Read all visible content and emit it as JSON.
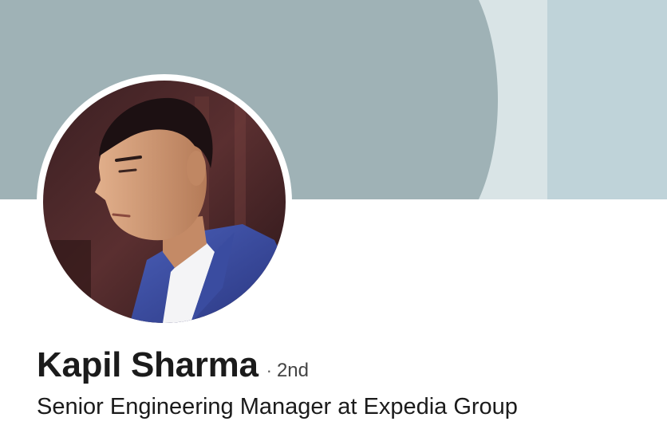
{
  "profile": {
    "name": "Kapil Sharma",
    "separator": "·",
    "connection_degree": "2nd",
    "headline": "Senior Engineering Manager at Expedia Group"
  },
  "colors": {
    "cover_main": "#9fb2b6",
    "cover_light": "#d9e4e6",
    "cover_right": "#bfd3d9",
    "text_primary": "#1b1b1b",
    "text_secondary": "#444444"
  }
}
